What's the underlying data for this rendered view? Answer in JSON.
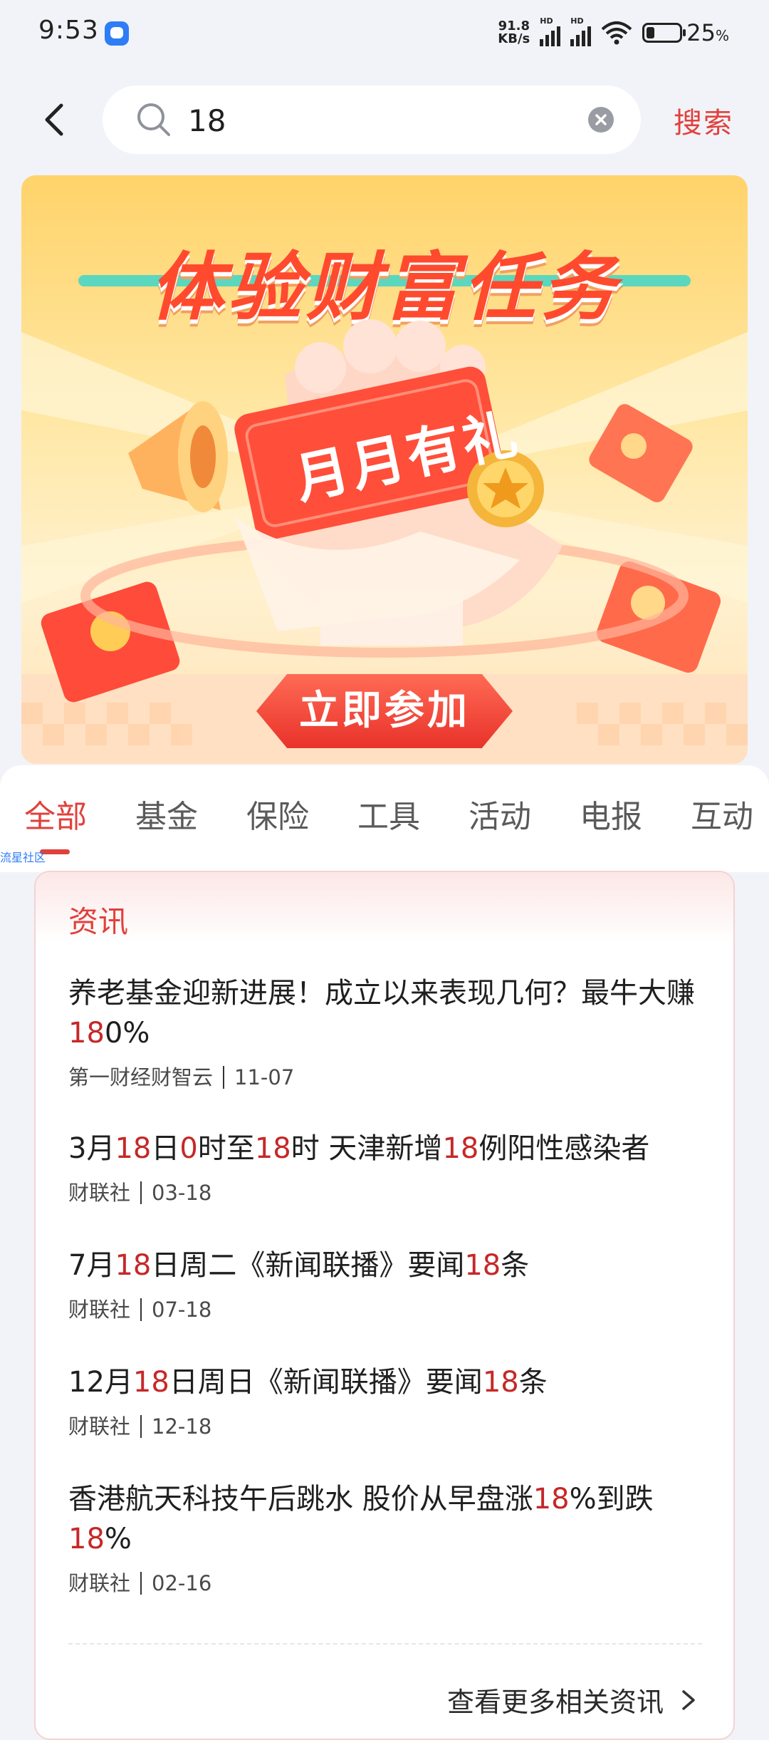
{
  "status_bar": {
    "time": "9:53",
    "net_speed_value": "91.8",
    "net_speed_unit": "KB/s",
    "signal_1_label": "HD",
    "signal_2_label": "HD",
    "battery_percent": "25",
    "battery_unit": "%",
    "battery_level": 0.25
  },
  "search": {
    "value": "18",
    "button_label": "搜索"
  },
  "banner": {
    "title": "体验财富任务",
    "subtitle": "月月有礼",
    "cta_label": "立即参加"
  },
  "tabs": [
    {
      "label": "全部",
      "active": true
    },
    {
      "label": "基金",
      "active": false
    },
    {
      "label": "保险",
      "active": false
    },
    {
      "label": "工具",
      "active": false
    },
    {
      "label": "活动",
      "active": false
    },
    {
      "label": "电报",
      "active": false
    },
    {
      "label": "互动",
      "active": false
    }
  ],
  "watermark": "流星社区",
  "news": {
    "section_title": "资讯",
    "items": [
      {
        "parts": [
          {
            "t": "养老基金迎新进展！成立以来表现几何？最牛大赚"
          },
          {
            "t": "18",
            "hl": true
          },
          {
            "t": "0%"
          }
        ],
        "source": "第一财经财智云",
        "date": "11-07"
      },
      {
        "parts": [
          {
            "t": "3月"
          },
          {
            "t": "18",
            "hl": true
          },
          {
            "t": "日"
          },
          {
            "t": "0",
            "hl": true
          },
          {
            "t": "时至"
          },
          {
            "t": "18",
            "hl": true
          },
          {
            "t": "时 天津新增"
          },
          {
            "t": "18",
            "hl": true
          },
          {
            "t": "例阳性感染者"
          }
        ],
        "source": "财联社",
        "date": "03-18"
      },
      {
        "parts": [
          {
            "t": "7月"
          },
          {
            "t": "18",
            "hl": true
          },
          {
            "t": "日周二《新闻联播》要闻"
          },
          {
            "t": "18",
            "hl": true
          },
          {
            "t": "条"
          }
        ],
        "source": "财联社",
        "date": "07-18"
      },
      {
        "parts": [
          {
            "t": "12月"
          },
          {
            "t": "18",
            "hl": true
          },
          {
            "t": "日周日《新闻联播》要闻"
          },
          {
            "t": "18",
            "hl": true
          },
          {
            "t": "条"
          }
        ],
        "source": "财联社",
        "date": "12-18"
      },
      {
        "parts": [
          {
            "t": "香港航天科技午后跳水 股价从早盘涨"
          },
          {
            "t": "18",
            "hl": true
          },
          {
            "t": "%到跌"
          },
          {
            "t": "18",
            "hl": true
          },
          {
            "t": "%"
          }
        ],
        "source": "财联社",
        "date": "02-16"
      }
    ],
    "more_label": "查看更多相关资讯"
  },
  "colors": {
    "accent": "#e0413c",
    "highlight": "#c62828",
    "background": "#f2f3f8"
  },
  "icons": {
    "back": "chevron-left-icon",
    "search": "magnifier-icon",
    "clear": "clear-circle-icon",
    "more": "chevron-right-icon"
  }
}
